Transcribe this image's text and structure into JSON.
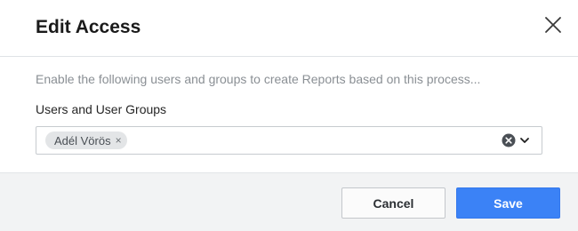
{
  "dialog": {
    "title": "Edit Access",
    "close_icon": "close-icon"
  },
  "body": {
    "description": "Enable the following users and groups to create Reports based on this process...",
    "field_label": "Users and User Groups",
    "selected_tags": [
      {
        "label": "Adél Vörös",
        "remove_symbol": "×"
      }
    ],
    "clear_icon": "clear-circle-icon",
    "dropdown_icon": "chevron-down-icon"
  },
  "footer": {
    "cancel_label": "Cancel",
    "save_label": "Save"
  },
  "colors": {
    "primary": "#3b82f6",
    "footer_bg": "#f2f3f4",
    "tag_bg": "#e3e5e7"
  }
}
